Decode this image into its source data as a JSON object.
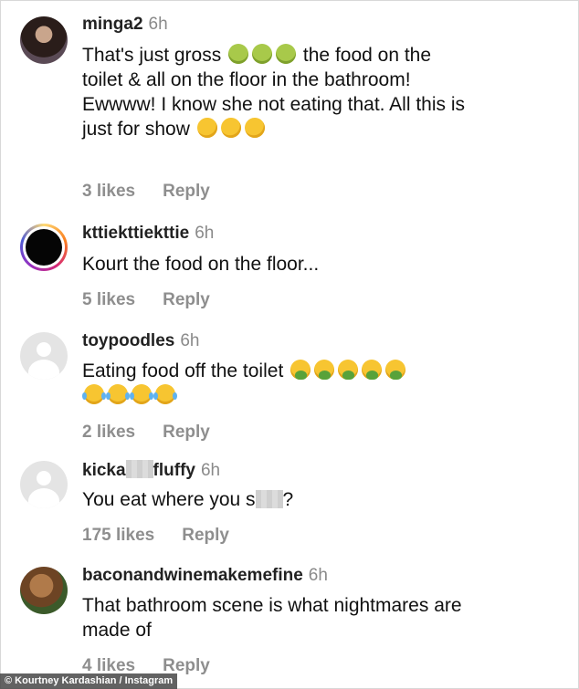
{
  "comments": [
    {
      "username": "minga2",
      "time": "6h",
      "text_1": "That's just gross",
      "emoji_1": [
        "nauseated-face",
        "nauseated-face",
        "nauseated-face"
      ],
      "text_2": "the food on the toilet & all on the floor in the bathroom! Ewwww! I know she not eating that. All this is just for show",
      "emoji_2": [
        "rolling-on-floor-laughing",
        "rolling-on-floor-laughing",
        "rolling-on-floor-laughing"
      ],
      "likes": "3 likes",
      "reply": "Reply"
    },
    {
      "username": "kttiekttiekttie",
      "time": "6h",
      "text": "Kourt the food on the floor...",
      "likes": "5 likes",
      "reply": "Reply"
    },
    {
      "username": "toypoodles",
      "time": "6h",
      "text": "Eating food off the toilet",
      "emoji_1": [
        "face-vomiting",
        "face-vomiting",
        "face-vomiting",
        "face-vomiting",
        "face-vomiting"
      ],
      "emoji_2": [
        "face-with-tears-of-joy",
        "face-with-tears-of-joy",
        "face-with-tears-of-joy",
        "face-with-tears-of-joy"
      ],
      "likes": "2 likes",
      "reply": "Reply"
    },
    {
      "username_part1": "kicka",
      "username_part2": "fluffy",
      "time": "6h",
      "text_part1": "You eat where you s",
      "text_part2": "?",
      "likes": "175 likes",
      "reply": "Reply"
    },
    {
      "username": "baconandwinemakemefine",
      "time": "6h",
      "text": "That bathroom scene is what nightmares are made of",
      "likes": "4 likes",
      "reply": "Reply"
    }
  ],
  "credit": "© Kourtney Kardashian / Instagram"
}
